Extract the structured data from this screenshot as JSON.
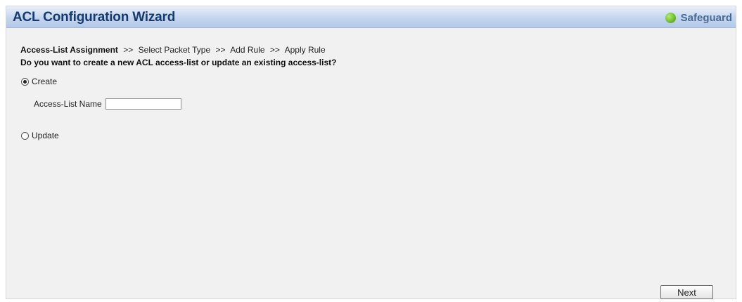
{
  "window": {
    "title": "ACL Configuration Wizard",
    "safeguard_label": "Safeguard",
    "safeguard_color": "#6cc32a"
  },
  "breadcrumb": {
    "current": "Access-List Assignment",
    "separator": ">>",
    "steps": [
      "Select Packet Type",
      "Add Rule",
      "Apply Rule"
    ]
  },
  "question": "Do you want to create a new ACL access-list or update an existing access-list?",
  "options": {
    "create_label": "Create",
    "update_label": "Update",
    "selected": "Create"
  },
  "access_list_name": {
    "label": "Access-List Name",
    "value": ""
  },
  "buttons": {
    "next_label": "Next"
  }
}
